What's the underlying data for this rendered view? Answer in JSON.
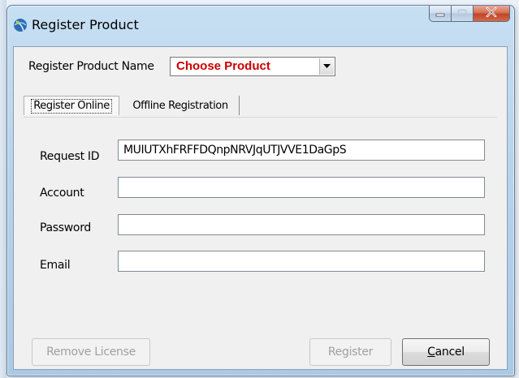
{
  "window": {
    "title": "Register Product"
  },
  "product": {
    "label": "Register Product Name",
    "selected": "Choose Product"
  },
  "tabs": [
    {
      "label": "Register Online",
      "active": true
    },
    {
      "label": "Offline Registration",
      "active": false
    }
  ],
  "form": {
    "request_id": {
      "label": "Request ID",
      "value": "MUIUTXhFRFFDQnpNRVJqUTJVVE1DaGpS"
    },
    "account": {
      "label": "Account",
      "value": ""
    },
    "password": {
      "label": "Password",
      "value": ""
    },
    "email": {
      "label": "Email",
      "value": ""
    }
  },
  "buttons": {
    "remove_license": "Remove License",
    "register": "Register",
    "cancel_prefix": "",
    "cancel_access": "C",
    "cancel_rest": "ancel"
  },
  "colors": {
    "accent_choose_product": "#cc0000",
    "close_button": "#c0442a"
  },
  "icons": {
    "app": "globe-icon",
    "dropdown": "chevron-down-icon",
    "minimize": "minimize-icon",
    "maximize": "maximize-icon",
    "close": "close-icon"
  }
}
